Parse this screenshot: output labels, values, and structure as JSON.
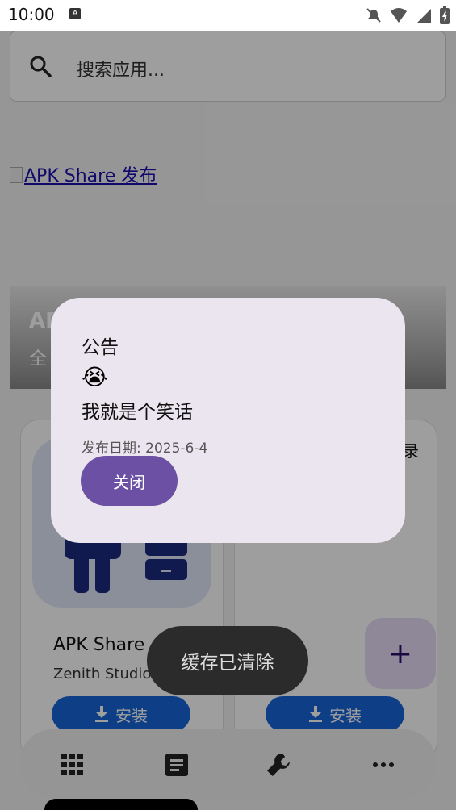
{
  "status_bar": {
    "time": "10:00",
    "notification_letter": "A"
  },
  "search": {
    "placeholder": "搜索应用..."
  },
  "banner": {
    "link_text": "APK Share 发布"
  },
  "hero": {
    "title": "AP",
    "subtitle": "全"
  },
  "cards": [
    {
      "name": "APK Share",
      "developer": "Zenith Studio",
      "install_label": "安装"
    },
    {
      "partial_text": "录",
      "install_label": "安装"
    }
  ],
  "fab": {
    "label": "+"
  },
  "bottom_nav": {
    "items": [
      "apps-grid-icon",
      "document-icon",
      "wrench-icon",
      "more-icon"
    ]
  },
  "dialog": {
    "title": "公告",
    "emoji": "😭",
    "body": "我就是个笑话",
    "date": "发布日期: 2025-6-4",
    "close_label": "关闭"
  },
  "toast": {
    "message": "缓存已清除"
  },
  "colors": {
    "accent": "#6c50a4",
    "install": "#1565d8",
    "dialog_bg": "#ebe5ef"
  }
}
